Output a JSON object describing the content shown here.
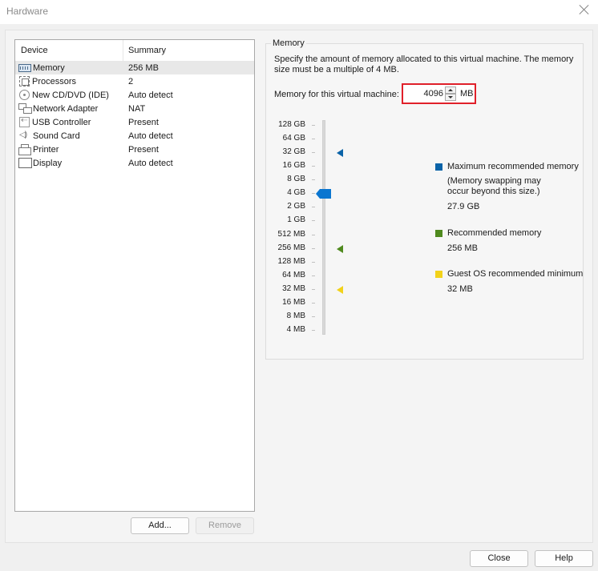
{
  "window": {
    "title": "Hardware",
    "close_icon": "close-icon"
  },
  "device_list": {
    "columns": [
      "Device",
      "Summary"
    ],
    "rows": [
      {
        "icon": "memory-icon",
        "name": "Memory",
        "summary": "256 MB",
        "selected": true
      },
      {
        "icon": "processor-icon",
        "name": "Processors",
        "summary": "2",
        "selected": false
      },
      {
        "icon": "cd-dvd-icon",
        "name": "New CD/DVD (IDE)",
        "summary": "Auto detect",
        "selected": false
      },
      {
        "icon": "network-adapter-icon",
        "name": "Network Adapter",
        "summary": "NAT",
        "selected": false
      },
      {
        "icon": "usb-icon",
        "name": "USB Controller",
        "summary": "Present",
        "selected": false
      },
      {
        "icon": "sound-card-icon",
        "name": "Sound Card",
        "summary": "Auto detect",
        "selected": false
      },
      {
        "icon": "printer-icon",
        "name": "Printer",
        "summary": "Present",
        "selected": false
      },
      {
        "icon": "display-icon",
        "name": "Display",
        "summary": "Auto detect",
        "selected": false
      }
    ],
    "add_label": "Add...",
    "remove_label": "Remove"
  },
  "memory": {
    "group_title": "Memory",
    "description": "Specify the amount of memory allocated to this virtual machine. The memory size must be a multiple of 4 MB.",
    "field_label": "Memory for this virtual machine:",
    "value": "4096",
    "unit": "MB",
    "highlight_color": "#e0202a",
    "slider": {
      "ticks": [
        "128 GB",
        "64 GB",
        "32 GB",
        "16 GB",
        "8 GB",
        "4 GB",
        "2 GB",
        "1 GB",
        "512 MB",
        "256 MB",
        "128 MB",
        "64 MB",
        "32 MB",
        "16 MB",
        "8 MB",
        "4 MB"
      ],
      "current_value": "4 GB",
      "thumb_color": "#0b76d0",
      "markers": [
        {
          "name": "maximum-recommended-marker",
          "at": "32 GB",
          "color": "#0a63a8"
        },
        {
          "name": "recommended-marker",
          "at": "256 MB",
          "color": "#4f8a1e"
        },
        {
          "name": "guest-os-minimum-marker",
          "at": "32 MB",
          "color": "#f2d21a"
        }
      ]
    },
    "legend": [
      {
        "color": "#0a63a8",
        "title": "Maximum recommended memory",
        "note": "(Memory swapping may occur beyond this size.)",
        "value": "27.9 GB"
      },
      {
        "color": "#4f8a1e",
        "title": "Recommended memory",
        "value": "256 MB"
      },
      {
        "color": "#f2d21a",
        "title": "Guest OS recommended minimum",
        "value": "32 MB"
      }
    ]
  },
  "footer": {
    "close_label": "Close",
    "help_label": "Help"
  }
}
